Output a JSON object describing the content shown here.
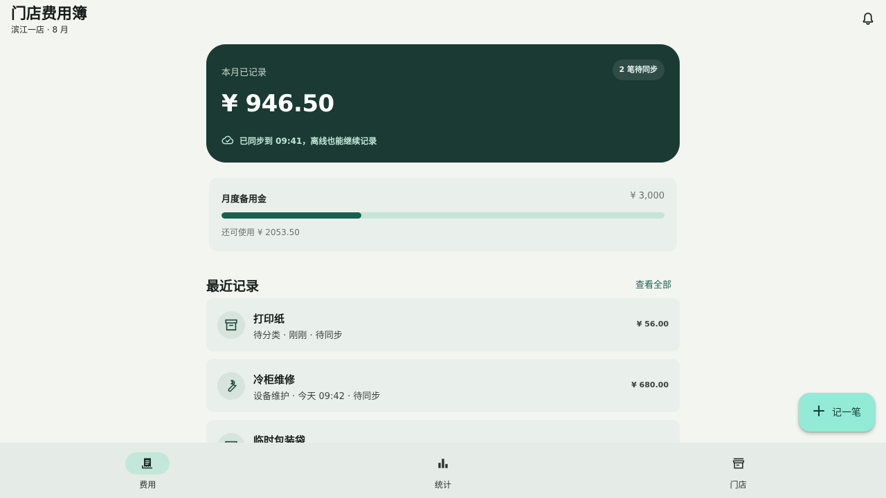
{
  "header": {
    "title": "门店费用簿",
    "subtitle": "滨江一店 · 8 月",
    "bell_icon": "bell-icon"
  },
  "summary": {
    "label": "本月已记录",
    "pending_badge": "2 笔待同步",
    "amount": "¥ 946.50",
    "sync_icon": "cloud-done-icon",
    "sync_status": "已同步到 09:41，离线也能继续记录"
  },
  "budget": {
    "title": "月度备用金",
    "total": "¥ 3,000",
    "used_fraction": 0.3155,
    "remaining": "还可使用 ¥ 2053.50"
  },
  "recent": {
    "title": "最近记录",
    "view_all": "查看全部",
    "items": [
      {
        "name": "打印纸",
        "meta": "待分类 · 刚刚 · 待同步",
        "amount": "¥ 56.00",
        "icon": "archive-box-icon"
      },
      {
        "name": "冷柜维修",
        "meta": "设备维护 · 今天 09:42 · 待同步",
        "amount": "¥ 680.00",
        "icon": "wrench-icon"
      },
      {
        "name": "临时包装袋",
        "meta": "",
        "amount": "",
        "icon": "archive-box-icon"
      }
    ]
  },
  "fab": {
    "label": "记一笔",
    "icon": "plus-icon"
  },
  "nav": {
    "items": [
      {
        "label": "费用",
        "icon": "receipt-icon",
        "active": true
      },
      {
        "label": "统计",
        "icon": "bar-chart-icon",
        "active": false
      },
      {
        "label": "门店",
        "icon": "store-icon",
        "active": false
      }
    ]
  },
  "colors": {
    "hero_background": "#1b3a33",
    "accent": "#16614f",
    "progress_track": "#c6e5d9",
    "fab_background": "#93ead6",
    "card_background": "#e9efea",
    "page_background": "#f3f5f1"
  }
}
